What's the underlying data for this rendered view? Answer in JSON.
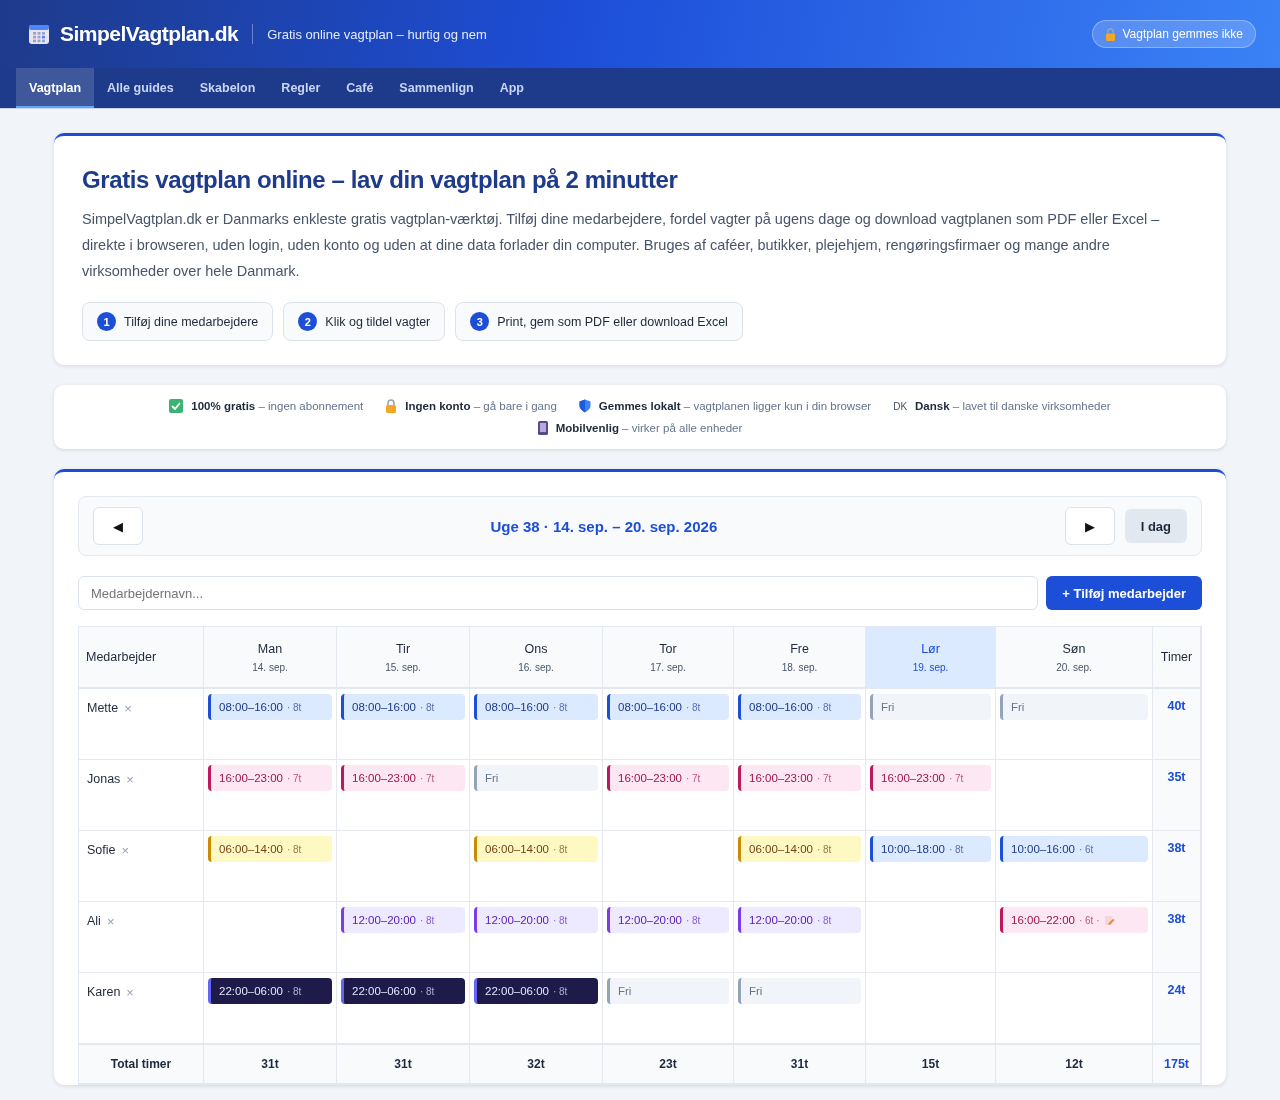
{
  "header": {
    "brand": "SimpelVagtplan.dk",
    "tagline": "Gratis online vagtplan – hurtig og nem",
    "notice": "Vagtplan gemmes ikke"
  },
  "nav": [
    {
      "label": "Vagtplan",
      "selected": true
    },
    {
      "label": "Alle guides",
      "selected": false
    },
    {
      "label": "Skabelon",
      "selected": false
    },
    {
      "label": "Regler",
      "selected": false
    },
    {
      "label": "Café",
      "selected": false
    },
    {
      "label": "Sammenlign",
      "selected": false
    },
    {
      "label": "App",
      "selected": false
    }
  ],
  "intro": {
    "title": "Gratis vagtplan online – lav din vagtplan på 2 minutter",
    "text": "SimpelVagtplan.dk er Danmarks enkleste gratis vagtplan-værktøj. Tilføj dine medarbejdere, fordel vagter på ugens dage og download vagtplanen som PDF eller Excel – direkte i browseren, uden login, uden konto og uden at dine data forlader din computer. Bruges af caféer, butikker, plejehjem, rengøringsfirmaer og mange andre virksomheder over hele Danmark.",
    "steps": [
      {
        "number": "1",
        "label": "Tilføj dine medarbejdere"
      },
      {
        "number": "2",
        "label": "Klik og tildel vagter"
      },
      {
        "number": "3",
        "label": "Print, gem som PDF eller download Excel"
      }
    ]
  },
  "features": [
    {
      "kind": "check",
      "title": "100% gratis",
      "text": "– ingen abonnement"
    },
    {
      "kind": "lock",
      "title": "Ingen konto",
      "text": "– gå bare i gang"
    },
    {
      "kind": "shield",
      "title": "Gemmes lokalt",
      "text": "– vagtplanen ligger kun i din browser"
    },
    {
      "kind": "flag",
      "flag": "DK",
      "title": "Dansk",
      "text": "– lavet til danske virksomheder"
    },
    {
      "kind": "phone",
      "title": "Mobilvenlig",
      "text": "– virker på alle enheder"
    }
  ],
  "planner": {
    "prev": "◀",
    "next": "▶",
    "week": "Uge 38 · 14. sep. – 20. sep. 2026",
    "today": "I dag",
    "name_field": {
      "placeholder": "Medarbejdernavn..."
    },
    "add_button": "+ Tilføj medarbejder",
    "employee_heading": "Medarbejder",
    "hours_heading": "Timer",
    "total_label": "Total timer",
    "days": [
      {
        "name": "Man",
        "date": "14. sep.",
        "selected": false
      },
      {
        "name": "Tir",
        "date": "15. sep.",
        "selected": false
      },
      {
        "name": "Ons",
        "date": "16. sep.",
        "selected": false
      },
      {
        "name": "Tor",
        "date": "17. sep.",
        "selected": false
      },
      {
        "name": "Fre",
        "date": "18. sep.",
        "selected": false
      },
      {
        "name": "Lør",
        "date": "19. sep.",
        "selected": true
      },
      {
        "name": "Søn",
        "date": "20. sep.",
        "selected": false
      }
    ],
    "rows": [
      {
        "name": "Mette",
        "remove": "×",
        "total": "40t",
        "shifts": [
          {
            "kind": "day",
            "time": "08:00–16:00",
            "hours": "· 8t"
          },
          {
            "kind": "day",
            "time": "08:00–16:00",
            "hours": "· 8t"
          },
          {
            "kind": "day",
            "time": "08:00–16:00",
            "hours": "· 8t"
          },
          {
            "kind": "day",
            "time": "08:00–16:00",
            "hours": "· 8t"
          },
          {
            "kind": "day",
            "time": "08:00–16:00",
            "hours": "· 8t"
          },
          {
            "kind": "off",
            "time": "Fri"
          },
          {
            "kind": "off",
            "time": "Fri"
          }
        ]
      },
      {
        "name": "Jonas",
        "remove": "×",
        "total": "35t",
        "shifts": [
          {
            "kind": "evening",
            "time": "16:00–23:00",
            "hours": "· 7t"
          },
          {
            "kind": "evening",
            "time": "16:00–23:00",
            "hours": "· 7t"
          },
          {
            "kind": "off",
            "time": "Fri"
          },
          {
            "kind": "evening",
            "time": "16:00–23:00",
            "hours": "· 7t"
          },
          {
            "kind": "evening",
            "time": "16:00–23:00",
            "hours": "· 7t"
          },
          {
            "kind": "evening",
            "time": "16:00–23:00",
            "hours": "· 7t"
          },
          {
            "kind": "none"
          }
        ]
      },
      {
        "name": "Sofie",
        "remove": "×",
        "total": "38t",
        "shifts": [
          {
            "kind": "morning",
            "time": "06:00–14:00",
            "hours": "· 8t"
          },
          {
            "kind": "none"
          },
          {
            "kind": "morning",
            "time": "06:00–14:00",
            "hours": "· 8t"
          },
          {
            "kind": "none"
          },
          {
            "kind": "morning",
            "time": "06:00–14:00",
            "hours": "· 8t"
          },
          {
            "kind": "day",
            "time": "10:00–18:00",
            "hours": "· 8t"
          },
          {
            "kind": "day",
            "time": "10:00–16:00",
            "hours": "· 6t"
          }
        ]
      },
      {
        "name": "Ali",
        "remove": "×",
        "total": "38t",
        "shifts": [
          {
            "kind": "none"
          },
          {
            "kind": "mid",
            "time": "12:00–20:00",
            "hours": "· 8t"
          },
          {
            "kind": "mid",
            "time": "12:00–20:00",
            "hours": "· 8t"
          },
          {
            "kind": "mid",
            "time": "12:00–20:00",
            "hours": "· 8t"
          },
          {
            "kind": "mid",
            "time": "12:00–20:00",
            "hours": "· 8t"
          },
          {
            "kind": "none"
          },
          {
            "kind": "evening",
            "time": "16:00–22:00",
            "hours": "· 6t ·",
            "note": true
          }
        ]
      },
      {
        "name": "Karen",
        "remove": "×",
        "total": "24t",
        "shifts": [
          {
            "kind": "night",
            "time": "22:00–06:00",
            "hours": "· 8t"
          },
          {
            "kind": "night",
            "time": "22:00–06:00",
            "hours": "· 8t"
          },
          {
            "kind": "night",
            "time": "22:00–06:00",
            "hours": "· 8t"
          },
          {
            "kind": "off",
            "time": "Fri"
          },
          {
            "kind": "off",
            "time": "Fri"
          },
          {
            "kind": "none"
          },
          {
            "kind": "none"
          }
        ]
      }
    ],
    "totals": [
      "31t",
      "31t",
      "32t",
      "23t",
      "31t",
      "15t",
      "12t"
    ],
    "grand_total": "175t"
  }
}
